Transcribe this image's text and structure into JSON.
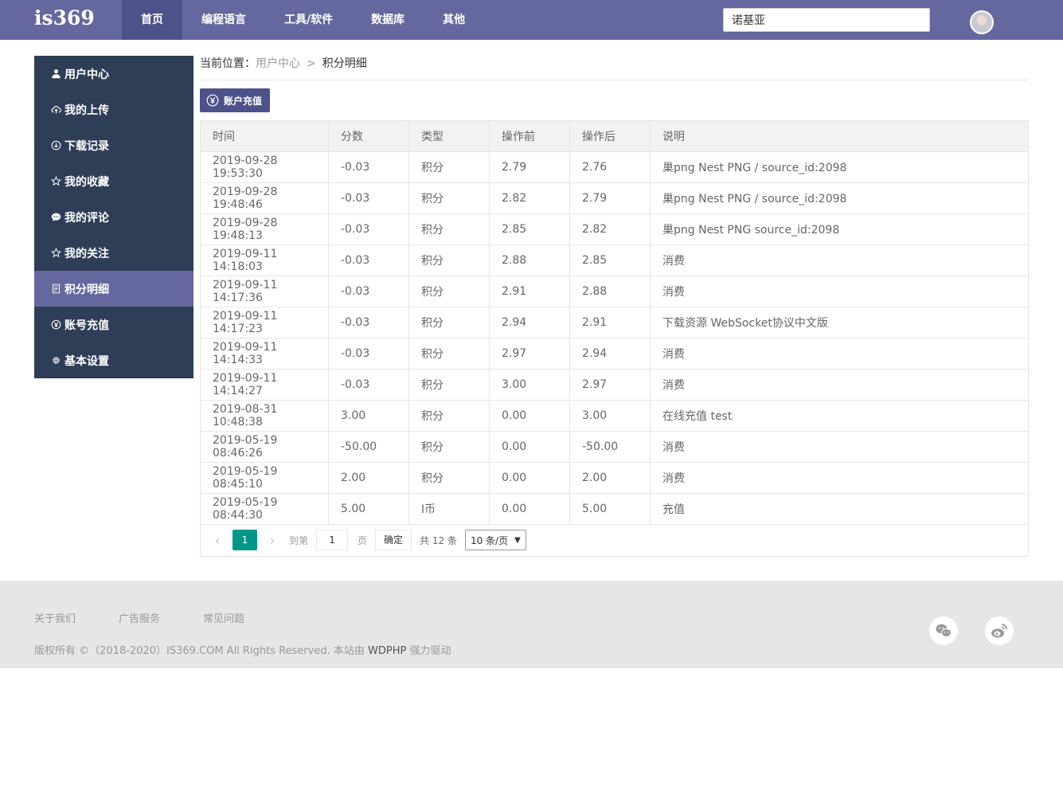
{
  "header": {
    "logo": "is369",
    "nav": [
      {
        "label": "首页",
        "active": true
      },
      {
        "label": "编程语言",
        "active": false
      },
      {
        "label": "工具/软件",
        "active": false
      },
      {
        "label": "数据库",
        "active": false
      },
      {
        "label": "其他",
        "active": false
      }
    ],
    "search_value": "诺基亚"
  },
  "sidebar": {
    "items": [
      {
        "label": "用户中心",
        "icon": "user-icon"
      },
      {
        "label": "我的上传",
        "icon": "cloud-upload-icon"
      },
      {
        "label": "下载记录",
        "icon": "download-icon"
      },
      {
        "label": "我的收藏",
        "icon": "star-icon"
      },
      {
        "label": "我的评论",
        "icon": "comment-icon"
      },
      {
        "label": "我的关注",
        "icon": "star-outline-icon"
      },
      {
        "label": "积分明细",
        "icon": "list-icon",
        "active": true
      },
      {
        "label": "账号充值",
        "icon": "yuan-icon"
      },
      {
        "label": "基本设置",
        "icon": "gear-icon"
      }
    ]
  },
  "breadcrumb": {
    "prefix": "当前位置：",
    "link": "用户中心",
    "sep": ">",
    "current": "积分明细"
  },
  "recharge_button": "账户充值",
  "table": {
    "headers": [
      "时间",
      "分数",
      "类型",
      "操作前",
      "操作后",
      "说明"
    ],
    "rows": [
      [
        "2019-09-28 19:53:30",
        "-0.03",
        "积分",
        "2.79",
        "2.76",
        "巢png Nest PNG / source_id:2098"
      ],
      [
        "2019-09-28 19:48:46",
        "-0.03",
        "积分",
        "2.82",
        "2.79",
        "巢png Nest PNG / source_id:2098"
      ],
      [
        "2019-09-28 19:48:13",
        "-0.03",
        "积分",
        "2.85",
        "2.82",
        "巢png Nest PNG source_id:2098"
      ],
      [
        "2019-09-11 14:18:03",
        "-0.03",
        "积分",
        "2.88",
        "2.85",
        "消费"
      ],
      [
        "2019-09-11 14:17:36",
        "-0.03",
        "积分",
        "2.91",
        "2.88",
        "消费"
      ],
      [
        "2019-09-11 14:17:23",
        "-0.03",
        "积分",
        "2.94",
        "2.91",
        "下载资源 WebSocket协议中文版"
      ],
      [
        "2019-09-11 14:14:33",
        "-0.03",
        "积分",
        "2.97",
        "2.94",
        "消费"
      ],
      [
        "2019-09-11 14:14:27",
        "-0.03",
        "积分",
        "3.00",
        "2.97",
        "消费"
      ],
      [
        "2019-08-31 10:48:38",
        "3.00",
        "积分",
        "0.00",
        "3.00",
        "在线充值 test"
      ],
      [
        "2019-05-19 08:46:26",
        "-50.00",
        "积分",
        "0.00",
        "-50.00",
        "消费"
      ],
      [
        "2019-05-19 08:45:10",
        "2.00",
        "积分",
        "0.00",
        "2.00",
        "消费"
      ],
      [
        "2019-05-19 08:44:30",
        "5.00",
        "I币",
        "0.00",
        "5.00",
        "充值"
      ]
    ]
  },
  "pager": {
    "current_page": "1",
    "goto_label": "到第",
    "goto_value": "1",
    "page_unit": "页",
    "ok_label": "确定",
    "total": "共 12 条",
    "page_size": "10 条/页"
  },
  "footer": {
    "links": [
      "关于我们",
      "广告服务",
      "常见问题"
    ],
    "copyright": "版权所有 ©（2018-2020）IS369.COM All Rights Reserved. 本站由",
    "powered_brand": "WDPHP",
    "powered_suffix": "强力驱动"
  },
  "colors": {
    "header_bg": "#64689e",
    "sidebar_bg": "#2e3e57",
    "active_page": "#009688"
  }
}
